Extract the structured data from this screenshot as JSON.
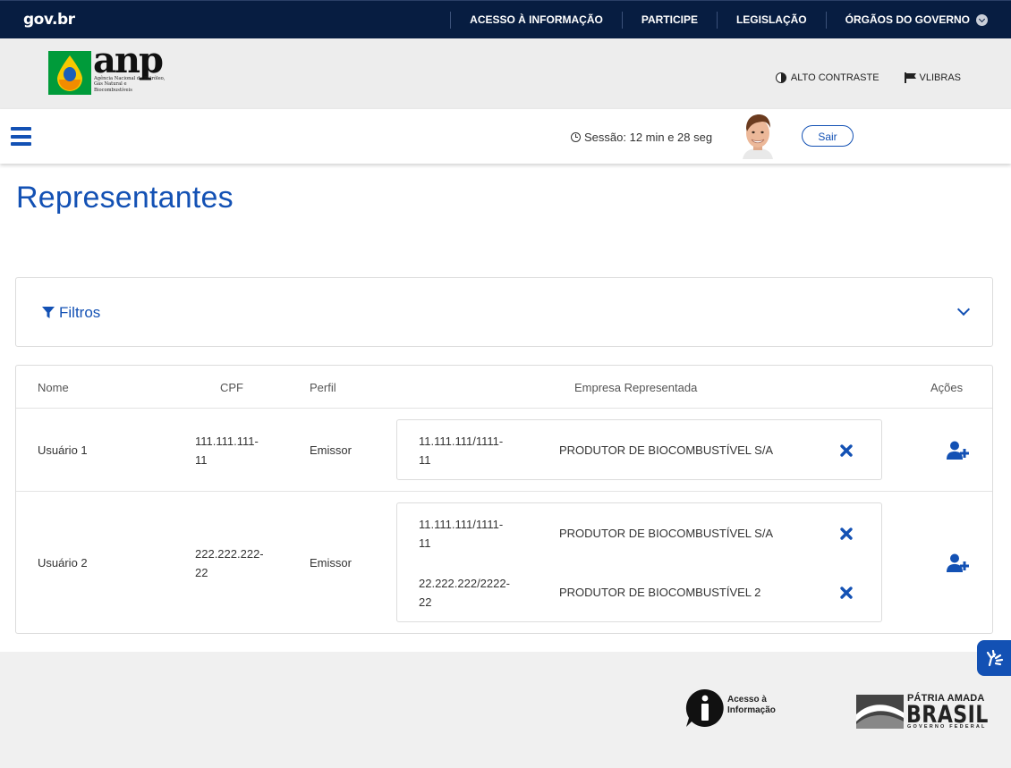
{
  "govbar": {
    "logo": "gov.br",
    "nav": [
      {
        "label": "ACESSO À INFORMAÇÃO"
      },
      {
        "label": "PARTICIPE"
      },
      {
        "label": "LEGISLAÇÃO"
      },
      {
        "label": "ÓRGÃOS DO GOVERNO"
      }
    ]
  },
  "agency": {
    "logo_word": "anp",
    "logo_sub": "Agência Nacional do Petróleo, Gás Natural e Biocombustíveis",
    "high_contrast": "ALTO CONTRASTE",
    "vlibras": "VLIBRAS"
  },
  "appbar": {
    "session_label": "Sessão: 12 min e 28 seg",
    "logout_label": "Sair"
  },
  "page": {
    "title": "Representantes"
  },
  "filters": {
    "label": "Filtros"
  },
  "table": {
    "headers": {
      "name": "Nome",
      "cpf": "CPF",
      "profile": "Perfil",
      "company": "Empresa Representada",
      "actions": "Ações"
    },
    "rows": [
      {
        "name": "Usuário 1",
        "cpf_line1": "111.111.111-",
        "cpf_line2": "11",
        "profile": "Emissor",
        "companies": [
          {
            "cnpj_line1": "11.111.111/1111-",
            "cnpj_line2": "11",
            "name": "PRODUTOR DE BIOCOMBUSTÍVEL S/A"
          }
        ]
      },
      {
        "name": "Usuário 2",
        "cpf_line1": "222.222.222-",
        "cpf_line2": "22",
        "profile": "Emissor",
        "companies": [
          {
            "cnpj_line1": "11.111.111/1111-",
            "cnpj_line2": "11",
            "name": "PRODUTOR DE BIOCOMBUSTÍVEL S/A"
          },
          {
            "cnpj_line1": "22.222.222/2222-",
            "cnpj_line2": "22",
            "name": "PRODUTOR DE BIOCOMBUSTÍVEL 2"
          }
        ]
      }
    ]
  },
  "footer": {
    "access_info_line1": "Acesso à",
    "access_info_line2": "Informação",
    "brasil_top": "PÁTRIA AMADA",
    "brasil_big": "BRASIL",
    "brasil_small": "GOVERNO FEDERAL"
  },
  "colors": {
    "primary": "#1351b4",
    "govbar": "#071d41",
    "header_bg": "#ededed",
    "footer_bg": "#f0f0f0"
  }
}
